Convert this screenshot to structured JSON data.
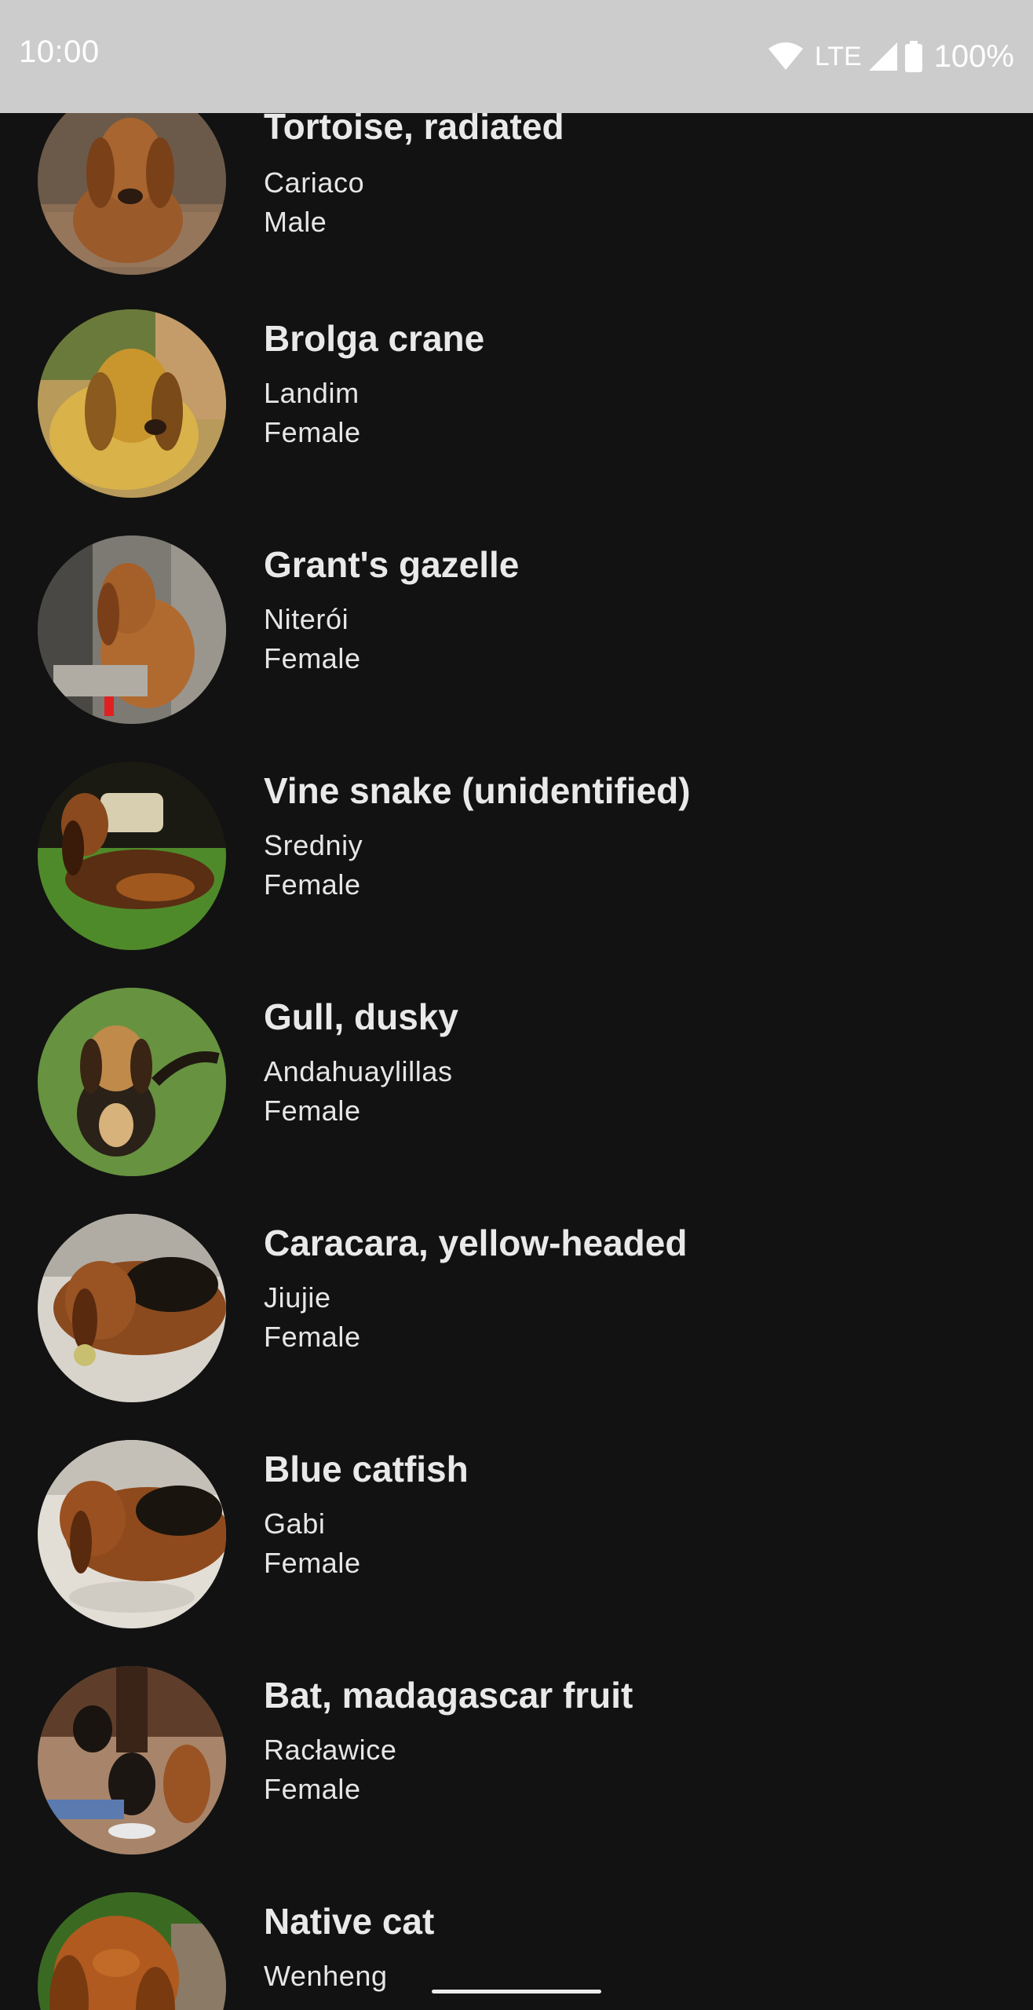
{
  "status_bar": {
    "time": "10:00",
    "network": "LTE",
    "battery": "100%",
    "icons": [
      "wifi-icon",
      "signal-icon",
      "battery-icon"
    ]
  },
  "theme": {
    "background": "#121212",
    "status_bar": "#cccccc",
    "text": "#e6e6e6"
  },
  "items": [
    {
      "name": "Tortoise, radiated",
      "location": "Cariaco",
      "gender": "Male"
    },
    {
      "name": "Brolga crane",
      "location": "Landim",
      "gender": "Female"
    },
    {
      "name": "Grant's gazelle",
      "location": "Niterói",
      "gender": "Female"
    },
    {
      "name": "Vine snake (unidentified)",
      "location": "Sredniy",
      "gender": "Female"
    },
    {
      "name": "Gull, dusky",
      "location": "Andahuaylillas",
      "gender": "Female"
    },
    {
      "name": "Caracara, yellow-headed",
      "location": "Jiujie",
      "gender": "Female"
    },
    {
      "name": "Blue catfish",
      "location": "Gabi",
      "gender": "Female"
    },
    {
      "name": "Bat, madagascar fruit",
      "location": "Racławice",
      "gender": "Female"
    },
    {
      "name": "Native cat",
      "location": "Wenheng",
      "gender": ""
    }
  ]
}
